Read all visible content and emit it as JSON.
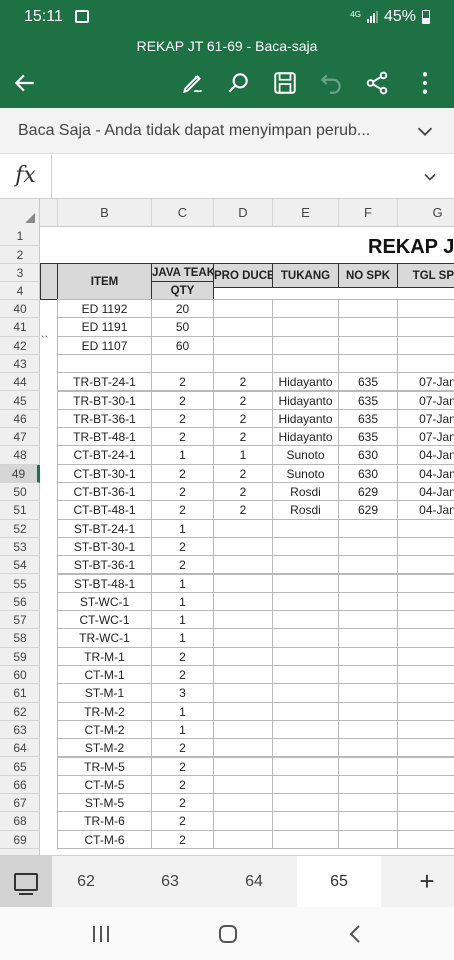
{
  "status_bar": {
    "time": "15:11",
    "network": "4G",
    "battery": "45%"
  },
  "title_bar": {
    "doc_title": "REKAP JT 61-69 - Baca-saja"
  },
  "banner": {
    "message": "Baca Saja - Anda tidak dapat menyimpan perub..."
  },
  "formula_bar": {
    "fx_label": "fx",
    "value": ""
  },
  "columns": [
    "B",
    "C",
    "D",
    "E",
    "F",
    "G"
  ],
  "sheet_title": "REKAP JT",
  "headers": {
    "item": "ITEM",
    "java_teak": "JAVA TEAK",
    "qty": "QTY",
    "produce": "PRO DUCE",
    "tukang": "TUKANG",
    "no_spk": "NO SPK",
    "tgl_spk": "TGL SPK"
  },
  "row_numbers": [
    "1",
    "2",
    "3",
    "4",
    "40",
    "41",
    "42",
    "43",
    "44",
    "45",
    "46",
    "47",
    "48",
    "49",
    "50",
    "51",
    "52",
    "53",
    "54",
    "55",
    "56",
    "57",
    "58",
    "59",
    "60",
    "61",
    "62",
    "63",
    "64",
    "65",
    "66",
    "67",
    "68",
    "69"
  ],
  "active_row": "49",
  "row_42_a_mark": "``",
  "data_rows": [
    [
      "ED 1192",
      "20",
      "",
      "",
      "",
      ""
    ],
    [
      "ED 1191",
      "50",
      "",
      "",
      "",
      ""
    ],
    [
      "ED 1107",
      "60",
      "",
      "",
      "",
      ""
    ],
    [
      "",
      "",
      "",
      "",
      "",
      ""
    ],
    [
      "TR-BT-24-1",
      "2",
      "2",
      "Hidayanto",
      "635",
      "07-Jan"
    ],
    [
      "TR-BT-30-1",
      "2",
      "2",
      "Hidayanto",
      "635",
      "07-Jan"
    ],
    [
      "TR-BT-36-1",
      "2",
      "2",
      "Hidayanto",
      "635",
      "07-Jan"
    ],
    [
      "TR-BT-48-1",
      "2",
      "2",
      "Hidayanto",
      "635",
      "07-Jan"
    ],
    [
      "CT-BT-24-1",
      "1",
      "1",
      "Sunoto",
      "630",
      "04-Jan"
    ],
    [
      "CT-BT-30-1",
      "2",
      "2",
      "Sunoto",
      "630",
      "04-Jan"
    ],
    [
      "CT-BT-36-1",
      "2",
      "2",
      "Rosdi",
      "629",
      "04-Jan"
    ],
    [
      "CT-BT-48-1",
      "2",
      "2",
      "Rosdi",
      "629",
      "04-Jan"
    ],
    [
      "ST-BT-24-1",
      "1",
      "",
      "",
      "",
      ""
    ],
    [
      "ST-BT-30-1",
      "2",
      "",
      "",
      "",
      ""
    ],
    [
      "ST-BT-36-1",
      "2",
      "",
      "",
      "",
      ""
    ],
    [
      "ST-BT-48-1",
      "1",
      "",
      "",
      "",
      ""
    ],
    [
      "ST-WC-1",
      "1",
      "",
      "",
      "",
      ""
    ],
    [
      "CT-WC-1",
      "1",
      "",
      "",
      "",
      ""
    ],
    [
      "TR-WC-1",
      "1",
      "",
      "",
      "",
      ""
    ],
    [
      "TR-M-1",
      "2",
      "",
      "",
      "",
      ""
    ],
    [
      "CT-M-1",
      "2",
      "",
      "",
      "",
      ""
    ],
    [
      "ST-M-1",
      "3",
      "",
      "",
      "",
      ""
    ],
    [
      "TR-M-2",
      "1",
      "",
      "",
      "",
      ""
    ],
    [
      "CT-M-2",
      "1",
      "",
      "",
      "",
      ""
    ],
    [
      "ST-M-2",
      "2",
      "",
      "",
      "",
      ""
    ],
    [
      "TR-M-5",
      "2",
      "",
      "",
      "",
      ""
    ],
    [
      "CT-M-5",
      "2",
      "",
      "",
      "",
      ""
    ],
    [
      "ST-M-5",
      "2",
      "",
      "",
      "",
      ""
    ],
    [
      "TR-M-6",
      "2",
      "",
      "",
      "",
      ""
    ],
    [
      "CT-M-6",
      "2",
      "",
      "",
      "",
      ""
    ]
  ],
  "sheet_tabs": [
    "62",
    "63",
    "64",
    "65"
  ],
  "selected_tab": "65",
  "add_sheet_label": "+",
  "icons": {
    "back": "arrow-left-icon",
    "draw": "pen-icon",
    "search": "search-icon",
    "save": "save-icon",
    "undo": "undo-icon",
    "share": "share-icon",
    "more": "more-vertical-icon",
    "recents": "recents-icon",
    "home": "home-icon",
    "nav_back": "nav-back-icon"
  },
  "colors": {
    "excel_green": "#1e7145",
    "header_fill": "#d9d9d9"
  }
}
